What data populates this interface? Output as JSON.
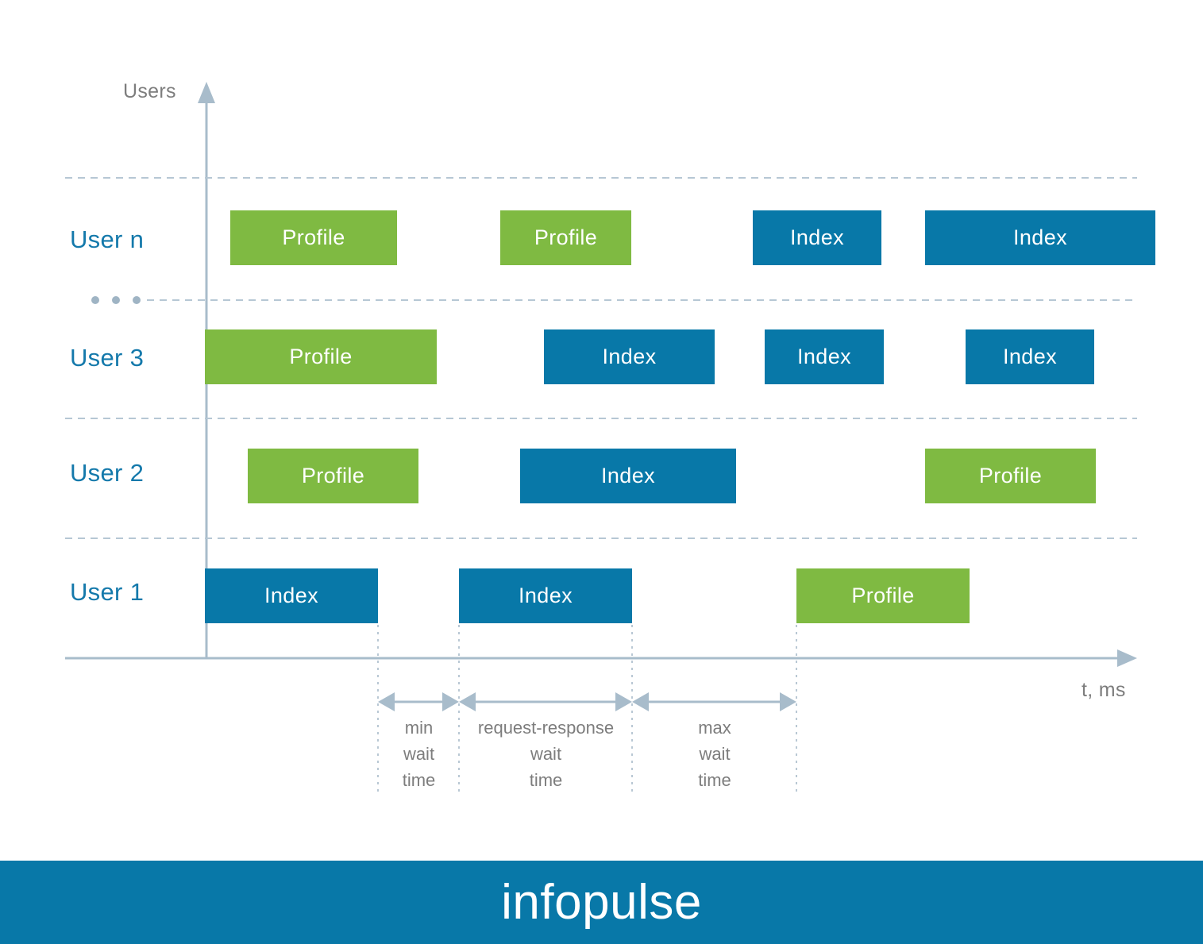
{
  "diagram": {
    "y_axis_label": "Users",
    "x_axis_label": "t, ms",
    "ellipsis": "• • •"
  },
  "rows": [
    {
      "label": "User n"
    },
    {
      "label": "User 3"
    },
    {
      "label": "User 2"
    },
    {
      "label": "User 1"
    }
  ],
  "bars": {
    "user_n": [
      {
        "label": "Profile",
        "kind": "profile"
      },
      {
        "label": "Profile",
        "kind": "profile"
      },
      {
        "label": "Index",
        "kind": "index"
      },
      {
        "label": "Index",
        "kind": "index"
      }
    ],
    "user_3": [
      {
        "label": "Profile",
        "kind": "profile"
      },
      {
        "label": "Index",
        "kind": "index"
      },
      {
        "label": "Index",
        "kind": "index"
      },
      {
        "label": "Index",
        "kind": "index"
      }
    ],
    "user_2": [
      {
        "label": "Profile",
        "kind": "profile"
      },
      {
        "label": "Index",
        "kind": "index"
      },
      {
        "label": "Profile",
        "kind": "profile"
      }
    ],
    "user_1": [
      {
        "label": "Index",
        "kind": "index"
      },
      {
        "label": "Index",
        "kind": "index"
      },
      {
        "label": "Profile",
        "kind": "profile"
      }
    ]
  },
  "measures": [
    {
      "line1": "min",
      "line2": "wait",
      "line3": "time"
    },
    {
      "line1": "request-response",
      "line2": "wait",
      "line3": "time"
    },
    {
      "line1": "max",
      "line2": "wait",
      "line3": "time"
    }
  ],
  "footer": {
    "wordmark": "infopulse"
  },
  "colors": {
    "profile": "#7fba42",
    "index": "#0878a8",
    "label": "#1479ab",
    "axis": "#a8bccb",
    "muted_text": "#7d7d7d",
    "footer_bg": "#0878a8"
  },
  "chart_data": {
    "type": "timeline",
    "title": "",
    "xlabel": "t, ms",
    "ylabel": "Users",
    "lanes": [
      "User n",
      "User 3",
      "User 2",
      "User 1"
    ],
    "series": [
      {
        "name": "User n",
        "tasks": [
          {
            "label": "Profile",
            "start": 290,
            "end": 500
          },
          {
            "label": "Profile",
            "start": 630,
            "end": 795
          },
          {
            "label": "Index",
            "start": 948,
            "end": 1110
          },
          {
            "label": "Index",
            "start": 1165,
            "end": 1455
          }
        ]
      },
      {
        "name": "User 3",
        "tasks": [
          {
            "label": "Profile",
            "start": 258,
            "end": 550
          },
          {
            "label": "Index",
            "start": 685,
            "end": 900
          },
          {
            "label": "Index",
            "start": 963,
            "end": 1113
          },
          {
            "label": "Index",
            "start": 1216,
            "end": 1378
          }
        ]
      },
      {
        "name": "User 2",
        "tasks": [
          {
            "label": "Profile",
            "start": 312,
            "end": 527
          },
          {
            "label": "Index",
            "start": 655,
            "end": 927
          },
          {
            "label": "Profile",
            "start": 1165,
            "end": 1380
          }
        ]
      },
      {
        "name": "User 1",
        "tasks": [
          {
            "label": "Index",
            "start": 258,
            "end": 476
          },
          {
            "label": "Index",
            "start": 578,
            "end": 796
          },
          {
            "label": "Profile",
            "start": 1003,
            "end": 1221
          }
        ]
      }
    ],
    "guides": [
      476,
      578,
      796,
      1003
    ],
    "intervals": [
      {
        "label": "min wait time",
        "from": 476,
        "to": 578
      },
      {
        "label": "request-response wait time",
        "from": 578,
        "to": 796
      },
      {
        "label": "max wait time",
        "from": 796,
        "to": 1003
      }
    ],
    "legend": [
      {
        "name": "Profile",
        "color": "#7fba42"
      },
      {
        "name": "Index",
        "color": "#0878a8"
      }
    ]
  }
}
